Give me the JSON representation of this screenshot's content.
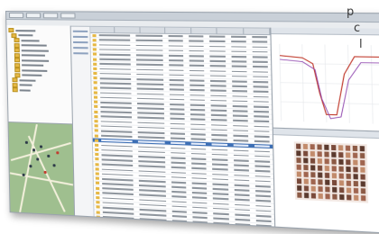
{
  "visible_text": {
    "line1": "p",
    "line2": "c",
    "line3": "l"
  },
  "colors": {
    "selection": "#3d6fb5",
    "plot_line_1": "#c0392b",
    "plot_line_2": "#8e44ad",
    "map_base": "#9fbf8f"
  },
  "icons": [
    "folder-icon",
    "map-marker-icon"
  ]
}
